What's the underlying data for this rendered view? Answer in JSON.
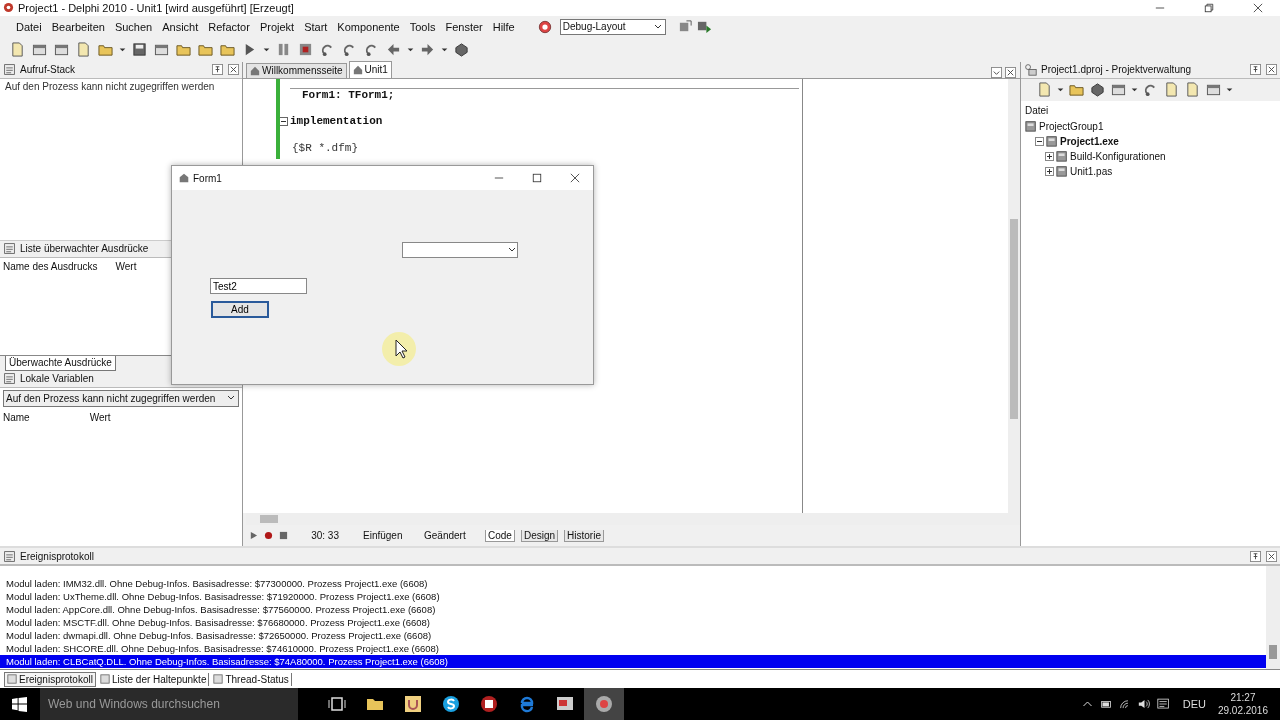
{
  "window": {
    "title": "Project1 - Delphi 2010 - Unit1 [wird ausgeführt] [Erzeugt]"
  },
  "menu": [
    "Datei",
    "Bearbeiten",
    "Suchen",
    "Ansicht",
    "Refactor",
    "Projekt",
    "Start",
    "Komponente",
    "Tools",
    "Fenster",
    "Hilfe"
  ],
  "layout_combo": {
    "value": "Debug-Layout"
  },
  "call_stack": {
    "title": "Aufruf-Stack",
    "message": "Auf den Prozess kann nicht zugegriffen werden"
  },
  "watches": {
    "title": "Liste überwachter Ausdrücke",
    "columns": [
      "Name des Ausdrucks",
      "Wert"
    ],
    "tabs": [
      {
        "label": "Überwachte Ausdrücke",
        "selected": true
      }
    ]
  },
  "locals": {
    "title": "Lokale Variablen",
    "combo": "Auf den Prozess kann nicht zugegriffen werden",
    "columns": [
      "Name",
      "Wert"
    ]
  },
  "editor": {
    "tabs": [
      {
        "label": "Willkommensseite",
        "selected": false
      },
      {
        "label": "Unit1",
        "selected": true
      }
    ],
    "lines": [
      {
        "kind": "code",
        "text": "Form1: TForm1;",
        "fold": false
      },
      {
        "kind": "keyword",
        "text": "implementation",
        "fold": true
      },
      {
        "kind": "directive",
        "text": "{$R *.dfm}",
        "fold": false
      }
    ]
  },
  "status": {
    "position": "30: 33",
    "mode": "Einfügen",
    "state": "Geändert",
    "tabs": [
      {
        "label": "Code",
        "selected": true
      },
      {
        "label": "Design",
        "selected": false
      },
      {
        "label": "Historie",
        "selected": false
      }
    ]
  },
  "project": {
    "title": "Project1.dproj - Projektverwaltung",
    "column": "Datei",
    "tree": [
      {
        "label": "ProjectGroup1",
        "active": false,
        "children": [
          {
            "label": "Project1.exe",
            "active": true,
            "expanded": true,
            "children": [
              {
                "label": "Build-Konfigurationen",
                "active": false,
                "expanded": false
              },
              {
                "label": "Unit1.pas",
                "active": false,
                "expanded": false
              }
            ]
          }
        ]
      }
    ]
  },
  "log": {
    "title": "Ereignisprotokoll",
    "lines": [
      {
        "text": "Modul laden: IMM32.dll. Ohne Debug-Infos. Basisadresse: $77300000. Prozess Project1.exe (6608)",
        "selected": false
      },
      {
        "text": "Modul laden: UxTheme.dll. Ohne Debug-Infos. Basisadresse: $71920000. Prozess Project1.exe (6608)",
        "selected": false
      },
      {
        "text": "Modul laden: AppCore.dll. Ohne Debug-Infos. Basisadresse: $77560000. Prozess Project1.exe (6608)",
        "selected": false
      },
      {
        "text": "Modul laden: MSCTF.dll. Ohne Debug-Infos. Basisadresse: $76680000. Prozess Project1.exe (6608)",
        "selected": false
      },
      {
        "text": "Modul laden: dwmapi.dll. Ohne Debug-Infos. Basisadresse: $72650000. Prozess Project1.exe (6608)",
        "selected": false
      },
      {
        "text": "Modul laden: SHCORE.dll. Ohne Debug-Infos. Basisadresse: $74610000. Prozess Project1.exe (6608)",
        "selected": false
      },
      {
        "text": "Modul laden: CLBCatQ.DLL. Ohne Debug-Infos. Basisadresse: $74A80000. Prozess Project1.exe (6608)",
        "selected": true
      }
    ],
    "tabs": [
      {
        "label": "Ereignisprotokoll",
        "selected": true
      },
      {
        "label": "Liste der Haltepunkte",
        "selected": false
      },
      {
        "label": "Thread-Status",
        "selected": false
      }
    ]
  },
  "form": {
    "title": "Form1",
    "edit": {
      "value": "Test2"
    },
    "button": "Add"
  },
  "taskbar": {
    "search": {
      "placeholder": "Web und Windows durchsuchen"
    },
    "language": "DEU",
    "time": "21:27",
    "date": "29.02.2016"
  }
}
